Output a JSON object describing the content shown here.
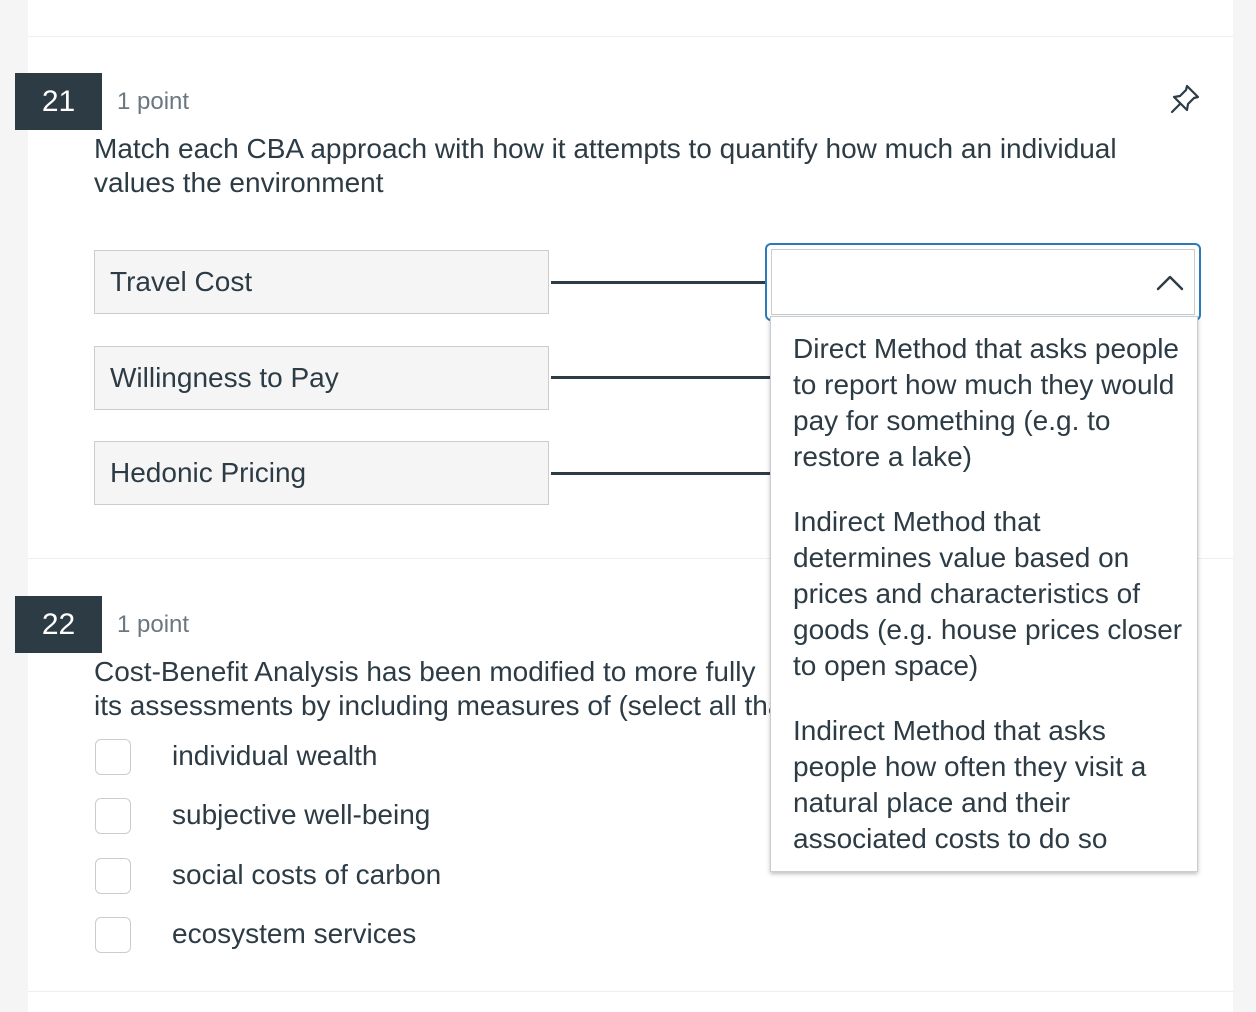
{
  "q21": {
    "number": "21",
    "points": "1 point",
    "text": "Match each CBA approach with how it attempts to quantify how much an individual values the environment",
    "items": [
      "Travel Cost",
      "Willingness to Pay",
      "Hedonic Pricing"
    ],
    "dropdown": {
      "selected": "",
      "options": [
        "Direct Method that asks people to report how much they would pay for something (e.g. to restore a lake)",
        "Indirect Method that determines value based on prices and characteristics of goods (e.g. house prices closer to open space)",
        "Indirect Method that asks people how often they visit a natural place and their associated costs to do so"
      ]
    }
  },
  "q22": {
    "number": "22",
    "points": "1 point",
    "text_line1": "Cost-Benefit Analysis has been modified to more fully",
    "text_line2": "its assessments by including measures of (select all tha",
    "choices": [
      "individual wealth",
      "subjective well-being",
      "social costs of carbon",
      "ecosystem services"
    ]
  },
  "icons": {
    "pin": "pin-icon",
    "chevron": "chevron-up-icon"
  },
  "colors": {
    "dark": "#2d3b45",
    "focus": "#2b7abc",
    "muted": "#6b7780"
  }
}
